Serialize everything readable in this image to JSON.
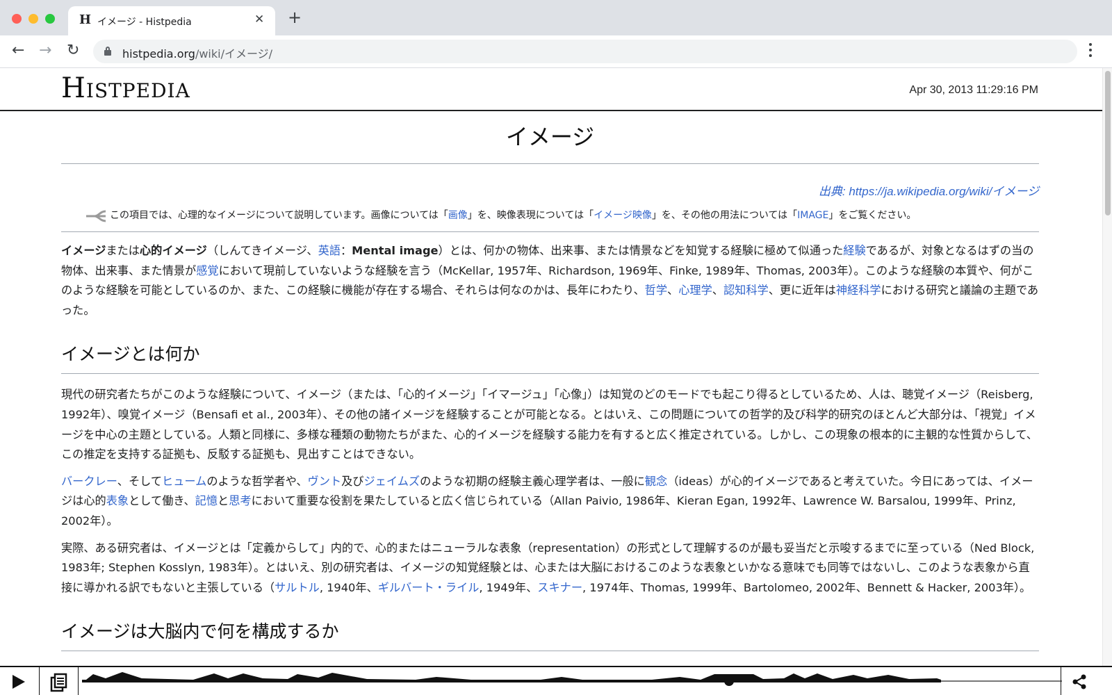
{
  "browser": {
    "tab_favicon": "H",
    "tab_title": "イメージ - Histpedia",
    "tab_close": "✕",
    "new_tab": "+",
    "url_host": "histpedia.org",
    "url_path": "/wiki/イメージ/"
  },
  "site": {
    "logo": "Histpedia",
    "timestamp": "Apr 30, 2013 11:29:16 PM"
  },
  "article": {
    "title": "イメージ",
    "source": "出典: https://ja.wikipedia.org/wiki/イメージ",
    "hatnote": {
      "t1": "この項目では、心理的なイメージについて説明しています。画像については「",
      "link1": "画像",
      "t2": "」を、映像表現については「",
      "link2": "イメージ映像",
      "t3": "」を、その他の用法については「",
      "link3": "IMAGE",
      "t4": "」をご覧ください。"
    },
    "lead": {
      "b1": "イメージ",
      "t1": "または",
      "b2": "心的イメージ",
      "t2": "（しんてきイメージ、",
      "link_english": "英語",
      "t3": "：",
      "b3": "Mental image",
      "t4": "）とは、何かの物体、出来事、または情景などを知覚する経験に極めて似通った",
      "link_experience": "経験",
      "t5": "であるが、対象となるはずの当の物体、出来事、また情景が",
      "link_sense": "感覚",
      "t6": "において現前していないような経験を言う（McKellar, 1957年、Richardson, 1969年、Finke, 1989年、Thomas, 2003年）。このような経験の本質や、何がこのような経験を可能としているのか、また、この経験に機能が存在する場合、それらは何なのかは、長年にわたり、",
      "link_philosophy": "哲学",
      "t7": "、",
      "link_psychology": "心理学",
      "t8": "、",
      "link_cognitive": "認知科学",
      "t9": "、更に近年は",
      "link_neuro": "神経科学",
      "t10": "における研究と議論の主題であった。"
    },
    "section1": {
      "heading": "イメージとは何か",
      "p1": "現代の研究者たちがこのような経験について、イメージ（または、「心的イメージ」「イマージュ」「心像」）は知覚のどのモードでも起こり得るとしているため、人は、聴覚イメージ（Reisberg, 1992年）、嗅覚イメージ（Bensafi et al., 2003年）、その他の諸イメージを経験することが可能となる。とはいえ、この問題についての哲学的及び科学的研究のほとんど大部分は、「視覚」イメージを中心の主題としている。人類と同様に、多様な種類の動物たちがまた、心的イメージを経験する能力を有すると広く推定されている。しかし、この現象の根本的に主観的な性質からして、この推定を支持する証拠も、反駁する証拠も、見出すことはできない。",
      "p2": {
        "link_berkeley": "バークレー",
        "t1": "、そして",
        "link_hume": "ヒューム",
        "t2": "のような哲学者や、",
        "link_wundt": "ヴント",
        "t3": "及び",
        "link_james": "ジェイムズ",
        "t4": "のような初期の経験主義心理学者は、一般に",
        "link_idea": "観念",
        "t5": "（ideas）が心的イメージであると考えていた。今日にあっては、イメージは心的",
        "link_representation": "表象",
        "t6": "として働き、",
        "link_memory": "記憶",
        "t7": "と",
        "link_thought": "思考",
        "t8": "において重要な役割を果たしていると広く信じられている（Allan Paivio, 1986年、Kieran Egan, 1992年、Lawrence W. Barsalou, 1999年、Prinz, 2002年）。"
      },
      "p3": {
        "t1": "実際、ある研究者は、イメージとは「定義からして」内的で、心的またはニューラルな表象（representation）の形式として理解するのが最も妥当だと示唆するまでに至っている（Ned Block, 1983年; Stephen Kosslyn, 1983年）。とはいえ、別の研究者は、イメージの知覚経験とは、心または大脳におけるこのような表象といかなる意味でも同等ではないし、このような表象から直接に導かれる訳でもないと主張している（",
        "link_sartre": "サルトル",
        "t2": ", 1940年、",
        "link_ryle": "ギルバート・ライル",
        "t3": ", 1949年、",
        "link_skinner": "スキナー",
        "t4": ", 1974年、Thomas, 1999年、Bartolomeo, 2002年、Bennett & Hacker, 2003年）。"
      }
    },
    "section2": {
      "heading": "イメージは大脳内で何を構成するか"
    }
  },
  "audio": {
    "progress": 0.66
  },
  "icons": {
    "back": "arrow-left-icon",
    "forward": "arrow-right-icon",
    "reload": "reload-icon",
    "lock": "lock-icon",
    "menu": "kebab-menu-icon",
    "hatnote": "disambiguation-icon",
    "play": "play-icon",
    "documents": "documents-icon",
    "share": "share-icon"
  }
}
